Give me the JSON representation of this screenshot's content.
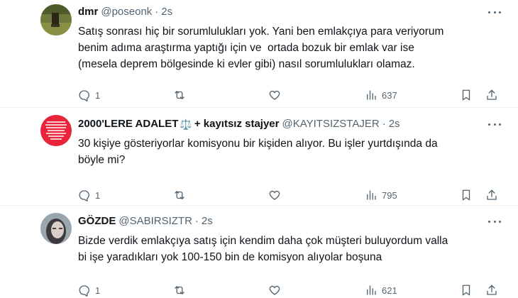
{
  "tweets": [
    {
      "name": "dmr",
      "handle": "@poseonk",
      "time": "2s",
      "text": "Satış sonrası hiç bir sorumlulukları yok. Yani ben emlakçıya para veriyorum\nbenim adıma araştırma yaptığı için ve  ortada bozuk bir emlak var ise\n(mesela deprem bölgesinde ki evler gibi) nasıl sorumlulukları olamaz.",
      "replies": "1",
      "retweets": "",
      "likes": "",
      "views": "637"
    },
    {
      "name": "2000'LERE ADALET",
      "name_emoji": "⚖️",
      "name_suffix": "+ kayıtsız stajyer",
      "handle": "@KAYITSIZSTAJER",
      "time": "2s",
      "text": "30 kişiye gösteriyorlar komisyonu bir kişiden alıyor. Bu işler yurtdışında da\nböyle mi?",
      "replies": "1",
      "retweets": "",
      "likes": "",
      "views": "795"
    },
    {
      "name": "GÖZDE",
      "handle": "@SABIRSIZTR",
      "time": "2s",
      "text": "Bizde verdik emlakçıya satış için kendim daha çok müşteri buluyordum valla\nbi işe yaradıkları yok 100-150 bin de komisyon alıyolar boşuna",
      "replies": "1",
      "retweets": "",
      "likes": "",
      "views": "621"
    }
  ],
  "icons": {
    "reply": "reply-icon",
    "retweet": "retweet-icon",
    "like": "like-icon",
    "views": "views-icon",
    "bookmark": "bookmark-icon",
    "share": "share-icon",
    "more": "more-icon"
  },
  "colors": {
    "text": "#0f1419",
    "secondary": "#536471",
    "divider": "#eff3f4"
  }
}
